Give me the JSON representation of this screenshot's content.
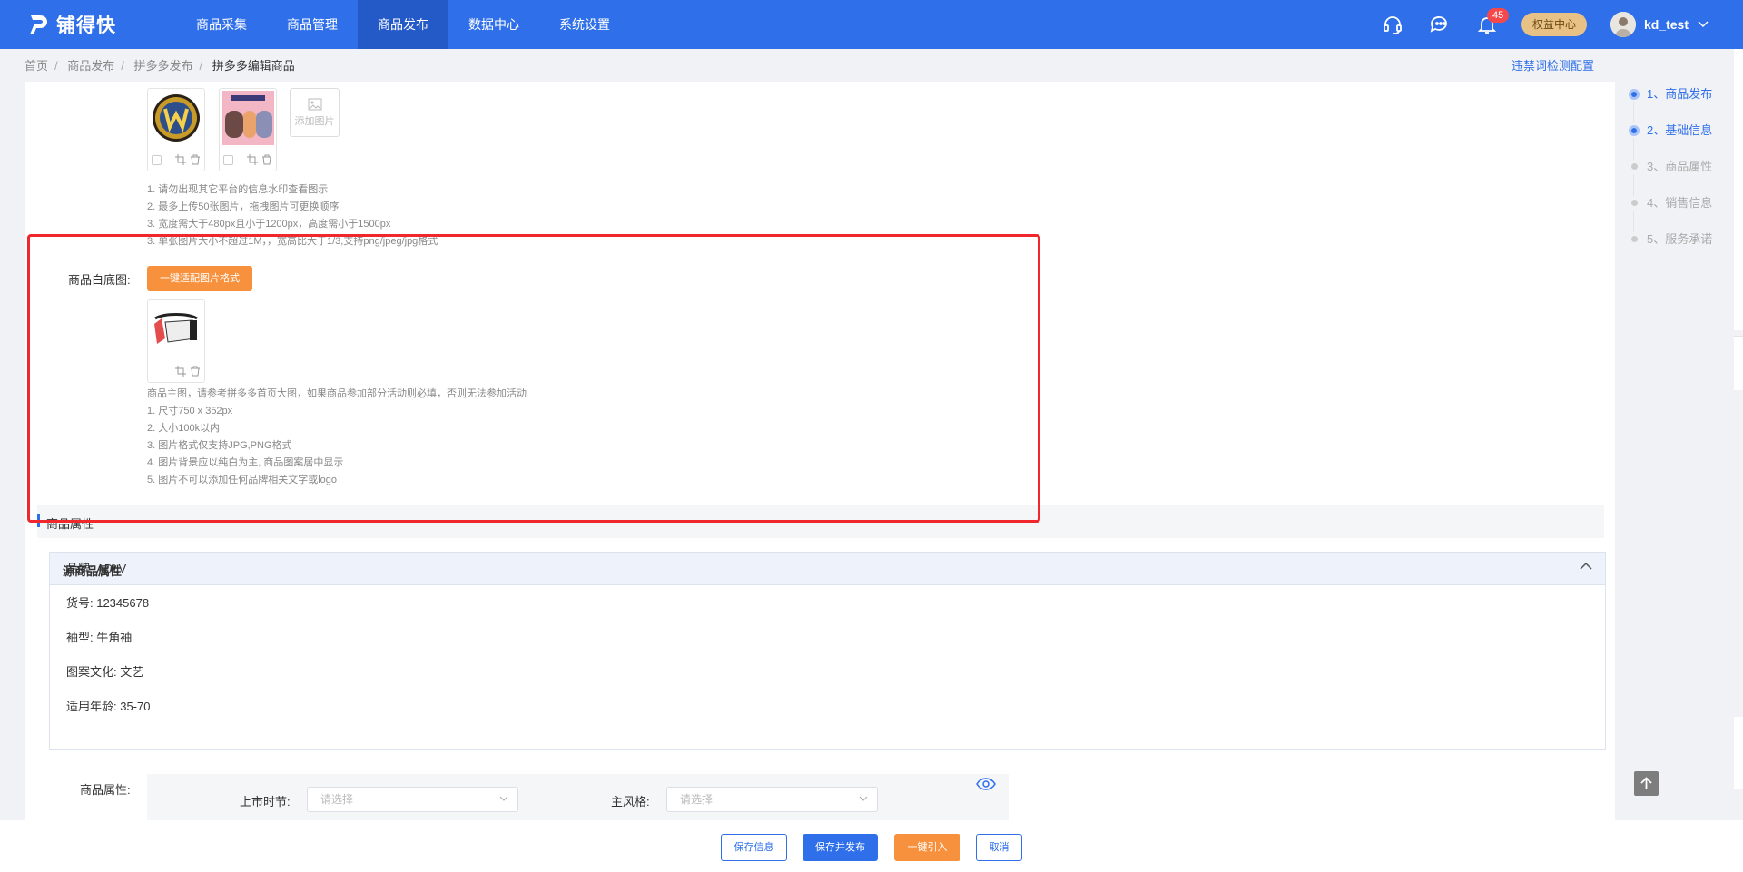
{
  "app": {
    "logo_text": "铺得快"
  },
  "nav": [
    {
      "label": "商品采集"
    },
    {
      "label": "商品管理"
    },
    {
      "label": "商品发布",
      "active": true
    },
    {
      "label": "数据中心"
    },
    {
      "label": "系统设置"
    }
  ],
  "header": {
    "notification_count": "45",
    "benefit_center": "权益中心",
    "username": "kd_test"
  },
  "breadcrumb": [
    "首页",
    "商品发布",
    "拼多多发布",
    "拼多多编辑商品"
  ],
  "banned_words_config": "违禁词检测配置",
  "gallery": {
    "add_image": "添加图片",
    "tips": [
      "1. 请勿出现其它平台的信息水印查看图示",
      "2. 最多上传50张图片，拖拽图片可更换顺序",
      "3. 宽度需大于480px且小于1200px，高度需小于1500px",
      "3. 单张图片大小不超过1M，，宽高比大于1/3,支持png/jpeg/jpg格式"
    ]
  },
  "white_bg": {
    "label": "商品白底图:",
    "adapt_button": "一键适配图片格式",
    "tips": [
      "商品主图，请参考拼多多首页大图，如果商品参加部分活动则必填，否则无法参加活动",
      "1. 尺寸750 x 352px",
      "2. 大小100k以内",
      "3. 图片格式仅支持JPG,PNG格式",
      "4. 图片背景应以纯白为主, 商品图案居中显示",
      "5. 图片不可以添加任何品牌相关文字或logo"
    ]
  },
  "section_attr": {
    "title": "商品属性"
  },
  "source_attrs": {
    "title": "源商品属性",
    "items": [
      "品牌: ADLV",
      "货号: 12345678",
      "袖型: 牛角袖",
      "图案文化: 文艺",
      "适用年龄: 35-70"
    ]
  },
  "attr_form": {
    "label": "商品属性:",
    "fields": [
      {
        "label": "上市时节:",
        "placeholder": "请选择"
      },
      {
        "label": "主风格:",
        "placeholder": "请选择"
      }
    ]
  },
  "steps": [
    {
      "label": "1、商品发布",
      "state": "done"
    },
    {
      "label": "2、基础信息",
      "state": "done"
    },
    {
      "label": "3、商品属性",
      "state": "todo"
    },
    {
      "label": "4、销售信息",
      "state": "todo"
    },
    {
      "label": "5、服务承诺",
      "state": "todo"
    }
  ],
  "footer_buttons": {
    "save": "保存信息",
    "save_publish": "保存并发布",
    "import": "一键引入",
    "cancel": "取消"
  },
  "colors": {
    "primary": "#2f6fea",
    "orange": "#f7913d",
    "highlight": "#f0272c"
  }
}
